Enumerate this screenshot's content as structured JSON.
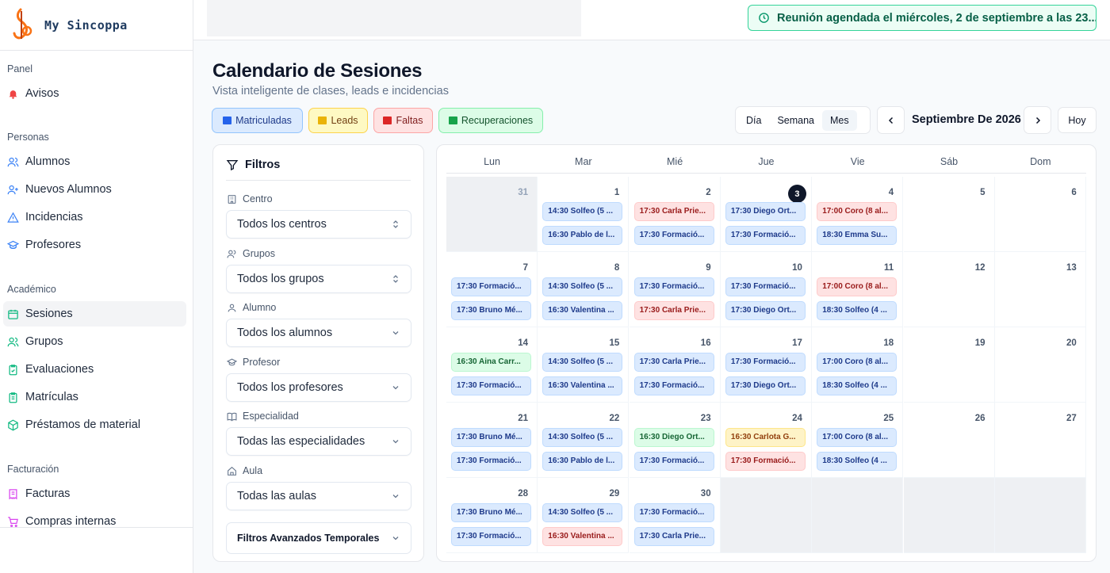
{
  "brand": {
    "name": "My Sincoppa"
  },
  "sidebar": {
    "sections": [
      {
        "title": "Panel",
        "items": [
          {
            "label": "Avisos",
            "icon": "bell-icon",
            "color": "#ef4444"
          }
        ]
      },
      {
        "title": "Personas",
        "items": [
          {
            "label": "Alumnos",
            "icon": "users-icon",
            "color": "#3b82f6"
          },
          {
            "label": "Nuevos Alumnos",
            "icon": "user-plus-icon",
            "color": "#3b82f6"
          },
          {
            "label": "Incidencias",
            "icon": "warning-icon",
            "color": "#3b82f6"
          },
          {
            "label": "Profesores",
            "icon": "graduation-cap-icon",
            "color": "#3b82f6"
          }
        ]
      },
      {
        "title": "Académico",
        "items": [
          {
            "label": "Sesiones",
            "icon": "calendar-icon",
            "color": "#10b981",
            "active": true
          },
          {
            "label": "Grupos",
            "icon": "users-icon",
            "color": "#10b981"
          },
          {
            "label": "Evaluaciones",
            "icon": "clipboard-check-icon",
            "color": "#10b981"
          },
          {
            "label": "Matrículas",
            "icon": "clipboard-icon",
            "color": "#10b981"
          },
          {
            "label": "Préstamos de material",
            "icon": "package-icon",
            "color": "#10b981"
          }
        ]
      },
      {
        "title": "Facturación",
        "items": [
          {
            "label": "Facturas",
            "icon": "invoice-icon",
            "color": "#d946ef"
          },
          {
            "label": "Compras internas",
            "icon": "cart-icon",
            "color": "#d946ef"
          }
        ]
      }
    ]
  },
  "toast": {
    "text": "Reunión agendada el miércoles, 2 de septiembre a las 23..."
  },
  "header": {
    "title": "Calendario de Sesiones",
    "subtitle": "Vista inteligente de clases, leads e incidencias"
  },
  "legend": [
    {
      "label": "Matriculadas",
      "color": "#2563eb"
    },
    {
      "label": "Leads",
      "color": "#eab308"
    },
    {
      "label": "Faltas",
      "color": "#dc2626"
    },
    {
      "label": "Recuperaciones",
      "color": "#16a34a"
    }
  ],
  "view": {
    "options": [
      "Día",
      "Semana",
      "Mes"
    ],
    "selected": "Mes",
    "month_label": "Septiembre De 2026",
    "today_label": "Hoy"
  },
  "filters": {
    "title": "Filtros",
    "fields": [
      {
        "label": "Centro",
        "value": "Todos los centros",
        "icon": "building-icon"
      },
      {
        "label": "Grupos",
        "value": "Todos los grupos",
        "icon": "users-icon"
      },
      {
        "label": "Alumno",
        "value": "Todos los alumnos",
        "icon": "user-icon"
      },
      {
        "label": "Profesor",
        "value": "Todos los profesores",
        "icon": "graduation-cap-icon"
      },
      {
        "label": "Especialidad",
        "value": "Todas las especialidades",
        "icon": "book-icon"
      },
      {
        "label": "Aula",
        "value": "Todas las aulas",
        "icon": "home-icon"
      }
    ],
    "advanced_label": "Filtros Avanzados Temporales"
  },
  "calendar": {
    "weekdays": [
      "Lun",
      "Mar",
      "Mié",
      "Jue",
      "Vie",
      "Sáb",
      "Dom"
    ],
    "today": 3,
    "weeks": [
      [
        {
          "day": "31",
          "out": true,
          "events": []
        },
        {
          "day": "1",
          "events": [
            {
              "text": "14:30 Solfeo (5 ...",
              "type": "blue"
            },
            {
              "text": "16:30 Pablo de l...",
              "type": "blue"
            }
          ]
        },
        {
          "day": "2",
          "events": [
            {
              "text": "17:30 Carla Prie...",
              "type": "red"
            },
            {
              "text": "17:30 Formació...",
              "type": "blue"
            }
          ]
        },
        {
          "day": "3",
          "events": [
            {
              "text": "17:30 Diego Ort...",
              "type": "blue"
            },
            {
              "text": "17:30 Formació...",
              "type": "blue"
            }
          ]
        },
        {
          "day": "4",
          "events": [
            {
              "text": "17:00 Coro (8 al...",
              "type": "red"
            },
            {
              "text": "18:30 Emma Su...",
              "type": "blue"
            }
          ]
        },
        {
          "day": "5",
          "events": []
        },
        {
          "day": "6",
          "events": []
        }
      ],
      [
        {
          "day": "7",
          "events": [
            {
              "text": "17:30 Formació...",
              "type": "blue"
            },
            {
              "text": "17:30 Bruno Mé...",
              "type": "blue"
            }
          ]
        },
        {
          "day": "8",
          "events": [
            {
              "text": "14:30 Solfeo (5 ...",
              "type": "blue"
            },
            {
              "text": "16:30 Valentina ...",
              "type": "blue"
            }
          ]
        },
        {
          "day": "9",
          "events": [
            {
              "text": "17:30 Formació...",
              "type": "blue"
            },
            {
              "text": "17:30 Carla Prie...",
              "type": "red"
            }
          ]
        },
        {
          "day": "10",
          "events": [
            {
              "text": "17:30 Formació...",
              "type": "blue"
            },
            {
              "text": "17:30 Diego Ort...",
              "type": "blue"
            }
          ]
        },
        {
          "day": "11",
          "events": [
            {
              "text": "17:00 Coro (8 al...",
              "type": "red"
            },
            {
              "text": "18:30 Solfeo (4 ...",
              "type": "blue"
            }
          ]
        },
        {
          "day": "12",
          "events": []
        },
        {
          "day": "13",
          "events": []
        }
      ],
      [
        {
          "day": "14",
          "events": [
            {
              "text": "16:30 Aina Carr...",
              "type": "green"
            },
            {
              "text": "17:30 Formació...",
              "type": "blue"
            }
          ]
        },
        {
          "day": "15",
          "events": [
            {
              "text": "14:30 Solfeo (5 ...",
              "type": "blue"
            },
            {
              "text": "16:30 Valentina ...",
              "type": "blue"
            }
          ]
        },
        {
          "day": "16",
          "events": [
            {
              "text": "17:30 Carla Prie...",
              "type": "blue"
            },
            {
              "text": "17:30 Formació...",
              "type": "blue"
            }
          ]
        },
        {
          "day": "17",
          "events": [
            {
              "text": "17:30 Formació...",
              "type": "blue"
            },
            {
              "text": "17:30 Diego Ort...",
              "type": "blue"
            }
          ]
        },
        {
          "day": "18",
          "events": [
            {
              "text": "17:00 Coro (8 al...",
              "type": "blue"
            },
            {
              "text": "18:30 Solfeo (4 ...",
              "type": "blue"
            }
          ]
        },
        {
          "day": "19",
          "events": []
        },
        {
          "day": "20",
          "events": []
        }
      ],
      [
        {
          "day": "21",
          "events": [
            {
              "text": "17:30 Bruno Mé...",
              "type": "blue"
            },
            {
              "text": "17:30 Formació...",
              "type": "blue"
            }
          ]
        },
        {
          "day": "22",
          "events": [
            {
              "text": "14:30 Solfeo (5 ...",
              "type": "blue"
            },
            {
              "text": "16:30 Pablo de l...",
              "type": "blue"
            }
          ]
        },
        {
          "day": "23",
          "events": [
            {
              "text": "16:30 Diego Ort...",
              "type": "green"
            },
            {
              "text": "17:30 Formació...",
              "type": "blue"
            }
          ]
        },
        {
          "day": "24",
          "events": [
            {
              "text": "16:30 Carlota G...",
              "type": "yellow"
            },
            {
              "text": "17:30 Formació...",
              "type": "red"
            }
          ]
        },
        {
          "day": "25",
          "events": [
            {
              "text": "17:00 Coro (8 al...",
              "type": "blue"
            },
            {
              "text": "18:30 Solfeo (4 ...",
              "type": "blue"
            }
          ]
        },
        {
          "day": "26",
          "events": []
        },
        {
          "day": "27",
          "events": []
        }
      ],
      [
        {
          "day": "28",
          "events": [
            {
              "text": "17:30 Bruno Mé...",
              "type": "blue"
            },
            {
              "text": "17:30 Formació...",
              "type": "blue"
            }
          ]
        },
        {
          "day": "29",
          "events": [
            {
              "text": "14:30 Solfeo (5 ...",
              "type": "blue"
            },
            {
              "text": "16:30 Valentina ...",
              "type": "red"
            }
          ]
        },
        {
          "day": "30",
          "events": [
            {
              "text": "17:30 Formació...",
              "type": "blue"
            },
            {
              "text": "17:30 Carla Prie...",
              "type": "blue"
            }
          ]
        },
        {
          "day": "",
          "out": true,
          "events": []
        },
        {
          "day": "",
          "out": true,
          "events": []
        },
        {
          "day": "",
          "out": true,
          "events": []
        },
        {
          "day": "",
          "out": true,
          "events": []
        }
      ]
    ]
  }
}
